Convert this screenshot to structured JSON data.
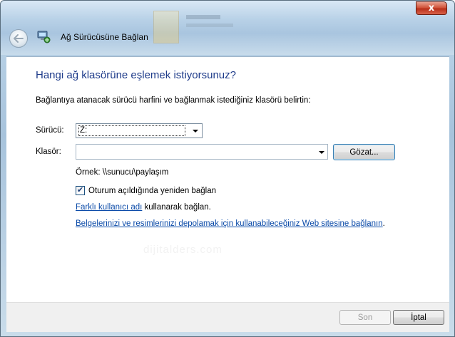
{
  "window": {
    "title": "Ağ Sürücüsüne Bağlan",
    "close_label": "x"
  },
  "page": {
    "heading": "Hangi ağ klasörüne eşlemek istiyorsunuz?",
    "intro": "Bağlantıya atanacak sürücü harfini ve bağlanmak istediğiniz klasörü belirtin:",
    "drive_label": "Sürücü:",
    "drive_value": "Z:",
    "folder_label": "Klasör:",
    "folder_value": "",
    "browse_label": "Gözat...",
    "example": "Örnek: \\\\sunucu\\paylaşım",
    "reconnect_label": "Oturum açıldığında yeniden bağlan",
    "reconnect_checked": true,
    "other_user_link": "Farklı kullanıcı adı",
    "other_user_suffix": " kullanarak bağlan.",
    "web_link": "Belgelerinizi ve resimlerinizi depolamak için kullanabileceğiniz Web sitesine bağlanın",
    "web_link_suffix": ".",
    "watermark": "dijitalders.com"
  },
  "footer": {
    "next_label": "Son",
    "cancel_label": "İptal"
  },
  "colors": {
    "heading": "#1e3b8a",
    "link": "#0a4aa8"
  }
}
